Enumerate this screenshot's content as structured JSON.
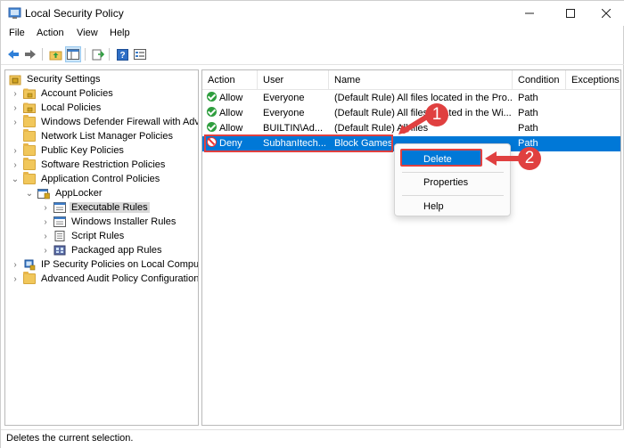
{
  "window": {
    "title": "Local Security Policy",
    "icon": "security-policy-icon"
  },
  "menu": [
    "File",
    "Action",
    "View",
    "Help"
  ],
  "toolbar": {
    "buttons": [
      "back-arrow-icon",
      "forward-arrow-icon",
      "up-folder-icon",
      "show-hide-tree-icon",
      "export-list-icon",
      "help-icon",
      "properties-icon"
    ]
  },
  "tree": [
    {
      "label": "Security Settings",
      "icon": "security-settings-icon",
      "expanded": true,
      "selected": false
    },
    {
      "label": "Account Policies",
      "icon": "folder-lock-icon",
      "expanded": false,
      "selected": false
    },
    {
      "label": "Local Policies",
      "icon": "folder-lock-icon",
      "expanded": false,
      "selected": false
    },
    {
      "label": "Windows Defender Firewall with Adva",
      "icon": "folder-icon",
      "expanded": false,
      "selected": false
    },
    {
      "label": "Network List Manager Policies",
      "icon": "folder-icon",
      "expanded": false,
      "selected": false
    },
    {
      "label": "Public Key Policies",
      "icon": "folder-icon",
      "expanded": false,
      "selected": false
    },
    {
      "label": "Software Restriction Policies",
      "icon": "folder-icon",
      "expanded": false,
      "selected": false
    },
    {
      "label": "Application Control Policies",
      "icon": "folder-icon",
      "expanded": true,
      "selected": false
    },
    {
      "label": "AppLocker",
      "icon": "applocker-icon",
      "expanded": true,
      "selected": false
    },
    {
      "label": "Executable Rules",
      "icon": "rules-icon",
      "expanded": false,
      "selected": true
    },
    {
      "label": "Windows Installer Rules",
      "icon": "rules-icon",
      "expanded": false,
      "selected": false
    },
    {
      "label": "Script Rules",
      "icon": "rules-icon",
      "expanded": false,
      "selected": false
    },
    {
      "label": "Packaged app Rules",
      "icon": "rules-icon",
      "expanded": false,
      "selected": false
    },
    {
      "label": "IP Security Policies on Local Compute",
      "icon": "ip-security-icon",
      "expanded": false,
      "selected": false
    },
    {
      "label": "Advanced Audit Policy Configuration",
      "icon": "folder-icon",
      "expanded": false,
      "selected": false
    }
  ],
  "list": {
    "columns": [
      "Action",
      "User",
      "Name",
      "Condition",
      "Exceptions"
    ],
    "rows": [
      {
        "action": "Allow",
        "user": "Everyone",
        "name": "(Default Rule) All files located in the Pro...",
        "condition": "Path",
        "exceptions": ""
      },
      {
        "action": "Allow",
        "user": "Everyone",
        "name": "(Default Rule) All files located in the Wi...",
        "condition": "Path",
        "exceptions": ""
      },
      {
        "action": "Allow",
        "user": "BUILTIN\\Ad...",
        "name": "(Default Rule) All files",
        "condition": "Path",
        "exceptions": ""
      },
      {
        "action": "Deny",
        "user": "SubhanItech...",
        "name": "Block Games",
        "condition": "Path",
        "exceptions": ""
      }
    ]
  },
  "context_menu": {
    "items": [
      "Delete",
      "Properties",
      "Help"
    ]
  },
  "callouts": [
    "1",
    "2"
  ],
  "status": "Deletes the current selection.",
  "colors": {
    "selection": "#0078d7",
    "annotation": "#e04040",
    "allow": "#2e9e3e"
  }
}
